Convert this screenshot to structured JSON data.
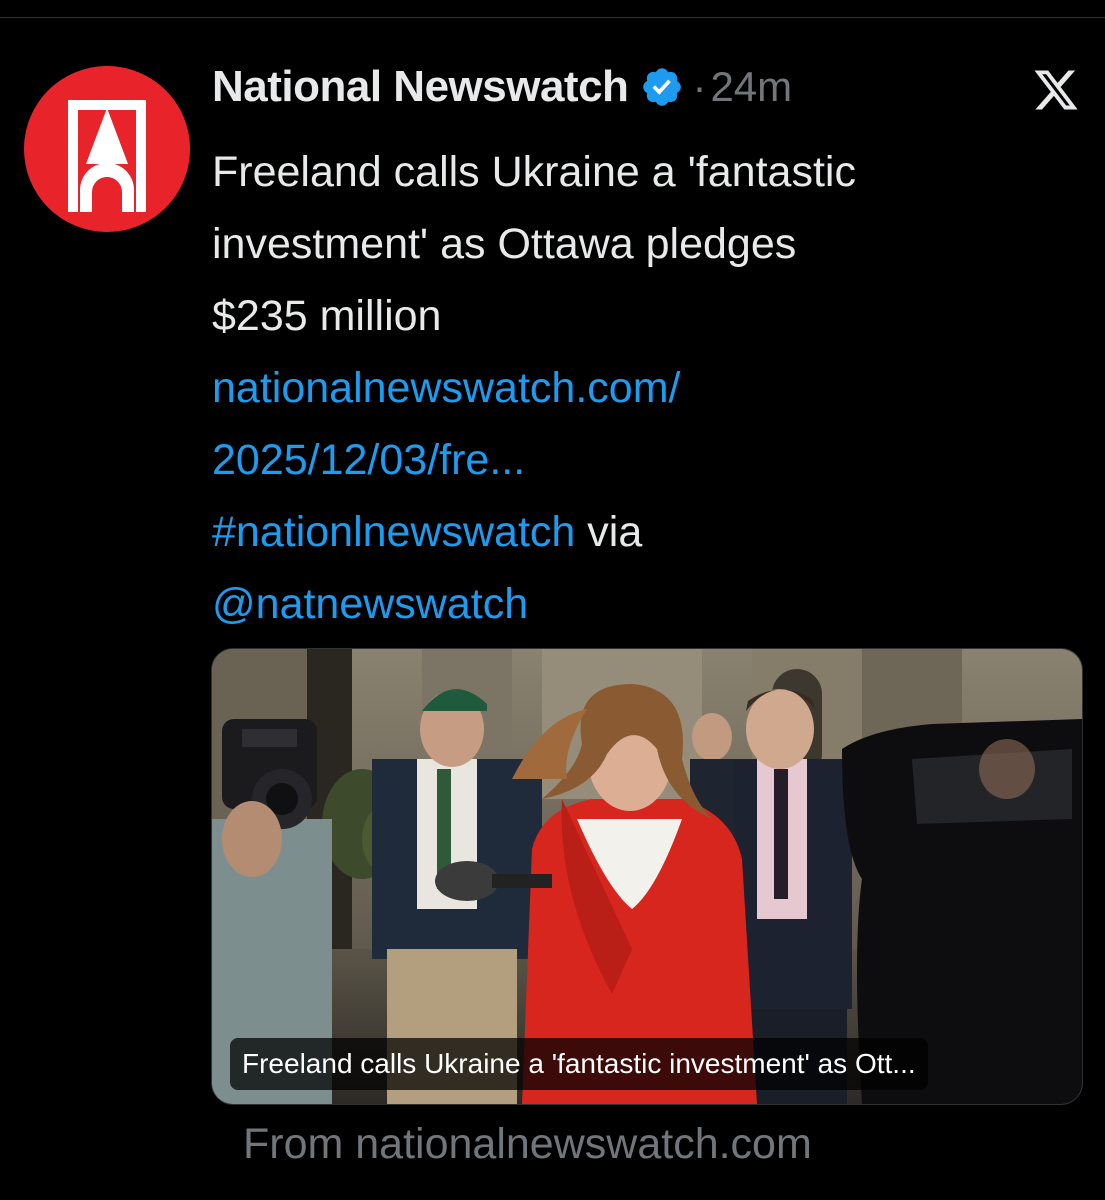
{
  "account": {
    "display_name": "National Newswatch",
    "verified_icon": "verified-badge-icon",
    "separator": "·",
    "time": "24m"
  },
  "tweet": {
    "line1": "Freeland calls Ukraine a 'fantastic",
    "line2": "investment' as Ottawa pledges",
    "line3": "$235 million",
    "link_line1": "nationalnewswatch.com/",
    "link_line2": "2025/12/03/fre...",
    "hashtag": "#nationlnewswatch",
    "via": " via",
    "mention": "@natnewswatch"
  },
  "card": {
    "caption": "Freeland calls Ukraine a 'fantastic investment' as Ott...",
    "source": "From nationalnewswatch.com"
  },
  "colors": {
    "background": "#000000",
    "text": "#e7e9ea",
    "secondary": "#71767b",
    "link": "#1d9bf0",
    "avatar_red": "#e8232a"
  },
  "icons": {
    "platform_logo": "x-logo-icon"
  }
}
